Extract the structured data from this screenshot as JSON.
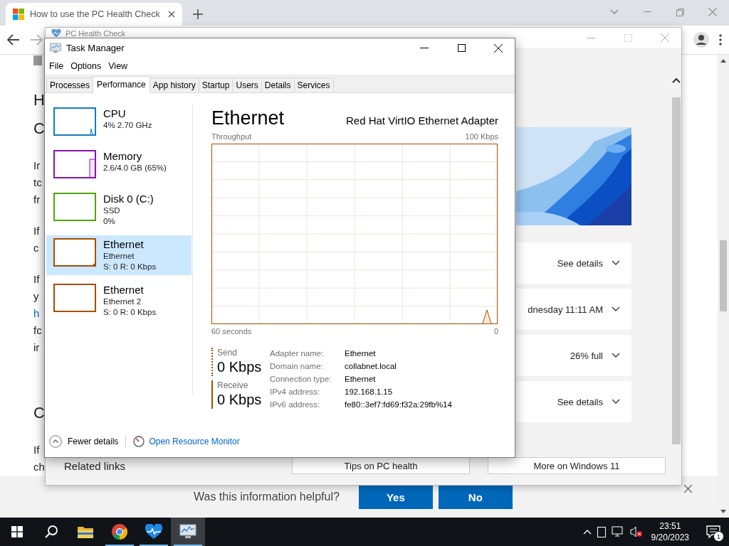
{
  "browser": {
    "tab": {
      "title": "How to use the PC Health Check",
      "selected": true
    },
    "page": {
      "blocks": [
        {
          "kind": "heading",
          "lines": [
            {
              "text": "H",
              "link": false
            },
            {
              "text": "C",
              "link": false
            }
          ]
        },
        {
          "kind": "para",
          "lines": [
            {
              "text": "Ir",
              "link": false
            },
            {
              "text": "tc",
              "link": false
            },
            {
              "text": "fr",
              "link": false
            }
          ]
        },
        {
          "kind": "para",
          "lines": [
            {
              "text": "If",
              "link": false
            },
            {
              "text": "c",
              "link": false
            }
          ]
        },
        {
          "kind": "para",
          "lines": [
            {
              "text": "If",
              "link": false
            },
            {
              "text": "y",
              "link": false
            },
            {
              "text": "h",
              "link": true
            },
            {
              "text": "fc",
              "link": false
            },
            {
              "text": "ir",
              "link": false
            }
          ]
        },
        {
          "kind": "heading",
          "lines": [
            {
              "text": "C",
              "link": false
            }
          ]
        },
        {
          "kind": "para",
          "lines": [
            {
              "text": "If",
              "link": false
            },
            {
              "text": "ch",
              "link": false
            }
          ]
        }
      ],
      "feedback": {
        "question": "Was this information helpful?",
        "buttons": [
          "Yes",
          "No"
        ]
      }
    }
  },
  "health_check": {
    "title": "PC Health Check",
    "cards": [
      {
        "text": "See details"
      },
      {
        "text": "dnesday 11:11 AM"
      },
      {
        "text": "26% full"
      },
      {
        "text": "See details"
      }
    ],
    "related": {
      "label": "Related links",
      "buttons": [
        "Tips on PC health",
        "More on Windows 11"
      ]
    }
  },
  "task_manager": {
    "title": "Task Manager",
    "menu": [
      "File",
      "Options",
      "View"
    ],
    "tabs": [
      {
        "label": "Processes",
        "selected": false
      },
      {
        "label": "Performance",
        "selected": true
      },
      {
        "label": "App history",
        "selected": false
      },
      {
        "label": "Startup",
        "selected": false
      },
      {
        "label": "Users",
        "selected": false
      },
      {
        "label": "Details",
        "selected": false
      },
      {
        "label": "Services",
        "selected": false
      }
    ],
    "resources": [
      {
        "name": "CPU",
        "details": [
          "4%  2.70 GHz"
        ],
        "color": "#117dbb",
        "kind": "spike",
        "selected": false
      },
      {
        "name": "Memory",
        "details": [
          "2.6/4.0 GB (65%)"
        ],
        "color": "#8b12ae",
        "kind": "fill",
        "selected": false
      },
      {
        "name": "Disk 0 (C:)",
        "details": [
          "SSD",
          "0%"
        ],
        "color": "#4da60c",
        "kind": "flat",
        "selected": false
      },
      {
        "name": "Ethernet",
        "details": [
          "Ethernet",
          "S: 0 R: 0 Kbps"
        ],
        "color": "#a74f01",
        "kind": "blip",
        "selected": true
      },
      {
        "name": "Ethernet",
        "details": [
          "Ethernet 2",
          "S: 0 R: 0 Kbps"
        ],
        "color": "#a74f01",
        "kind": "flat",
        "selected": false
      }
    ],
    "panel": {
      "title": "Ethernet",
      "adapter": "Red Hat VirtIO Ethernet Adapter",
      "chart_label": "Throughput",
      "max": "100 Kbps",
      "time_span": "60 seconds",
      "min": "0",
      "rates": [
        {
          "label": "Send",
          "value": "0 Kbps",
          "kind": "dotted"
        },
        {
          "label": "Receive",
          "value": "0 Kbps",
          "kind": "solid"
        }
      ],
      "properties": [
        {
          "label": "Adapter name:",
          "value": "Ethernet"
        },
        {
          "label": "Domain name:",
          "value": "collabnet.local"
        },
        {
          "label": "Connection type:",
          "value": "Ethernet"
        },
        {
          "label": "IPv4 address:",
          "value": "192.168.1.15"
        },
        {
          "label": "IPv6 address:",
          "value": "fe80::3ef7:fd69:f32a:29fb%14"
        }
      ]
    },
    "footer": {
      "fewer": "Fewer details",
      "monitor": "Open Resource Monitor"
    }
  },
  "taskbar": {
    "apps": [
      {
        "kind": "folder",
        "running": false,
        "selected": false
      },
      {
        "kind": "chrome",
        "running": true,
        "selected": false
      },
      {
        "kind": "health",
        "running": true,
        "selected": false
      },
      {
        "kind": "taskmgr",
        "running": true,
        "selected": true
      }
    ],
    "clock": {
      "time": "23:51",
      "date": "9/20/2023"
    },
    "notifications": "1"
  }
}
